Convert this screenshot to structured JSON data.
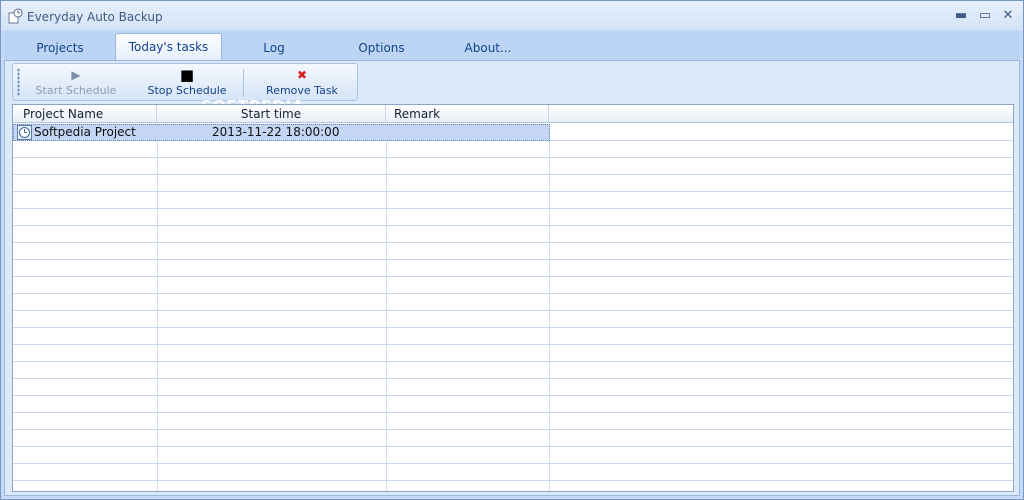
{
  "window": {
    "title": "Everyday Auto Backup",
    "controls": {
      "minimize": "▬",
      "maximize": "▭",
      "close": "✕"
    }
  },
  "tabs": [
    {
      "label": "Projects",
      "active": false
    },
    {
      "label": "Today's tasks",
      "active": true
    },
    {
      "label": "Log",
      "active": false
    },
    {
      "label": "Options",
      "active": false
    },
    {
      "label": "About...",
      "active": false
    }
  ],
  "toolbar": {
    "start_label": "Start Schedule",
    "stop_label": "Stop Schedule",
    "remove_label": "Remove Task",
    "start_glyph": "▶",
    "stop_glyph": "■",
    "remove_glyph": "✖",
    "colors": {
      "start": "#7f90a8",
      "stop": "#000000",
      "remove": "#d81f1f"
    }
  },
  "watermark": "SOFTPEDIA",
  "grid": {
    "columns": [
      "Project Name",
      "Start time",
      "Remark"
    ],
    "rows": [
      {
        "project": "Softpedia Project",
        "start_time": "2013-11-22 18:00:00",
        "remark": ""
      }
    ]
  },
  "colors": {
    "accent": "#15428b",
    "selection": "#c4d6f3",
    "background": "#c4dbf6"
  }
}
